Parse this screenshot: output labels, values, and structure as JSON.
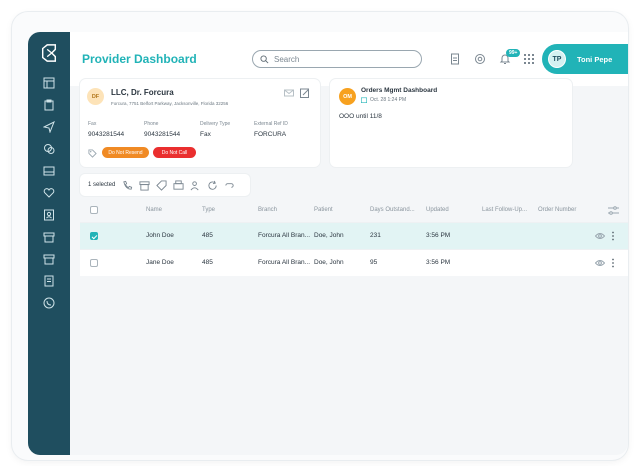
{
  "header": {
    "title": "Provider Dashboard",
    "search_placeholder": "Search",
    "notification_badge": "99+",
    "user": {
      "initials": "TP",
      "name": "Toni Pepe"
    }
  },
  "sidebar": {
    "items": [
      "dashboard",
      "clipboard",
      "send",
      "chat",
      "inbox",
      "heart",
      "contacts",
      "archive",
      "store",
      "document",
      "phone-circle"
    ]
  },
  "provider_card": {
    "initials": "DF",
    "name": "LLC, Dr. Forcura",
    "address": "Forcura, 7751 Belfort Parkway, Jacksonville, Florida 32256",
    "fields": [
      {
        "label": "Fax",
        "value": "9043281544"
      },
      {
        "label": "Phone",
        "value": "9043281544"
      },
      {
        "label": "Delivery Type",
        "value": "Fax"
      },
      {
        "label": "External Ref ID",
        "value": "FORCURA"
      }
    ],
    "tags": [
      "Do Not Resend",
      "Do Not Call"
    ]
  },
  "orders_card": {
    "initials": "OM",
    "title": "Orders Mgmt Dashboard",
    "date": "Oct. 28 1:24 PM",
    "note": "OOO until 11/8"
  },
  "action_bar": {
    "selected_text": "1 selected"
  },
  "table": {
    "columns": [
      "Name",
      "Type",
      "Branch",
      "Patient",
      "Days Outstand...",
      "Updated",
      "Last Follow-Up...",
      "Order Number"
    ],
    "rows": [
      {
        "selected": true,
        "name": "John Doe",
        "type": "485",
        "branch": "Forcura All Bran...",
        "patient": "Doe, John",
        "days": "231",
        "updated": "3:56 PM"
      },
      {
        "selected": false,
        "name": "Jane Doe",
        "type": "485",
        "branch": "Forcura All Bran...",
        "patient": "Doe, John",
        "days": "95",
        "updated": "3:56 PM"
      }
    ]
  },
  "colors": {
    "accent": "#21b3b7",
    "sidebar": "#1f4e5f",
    "orange": "#f08a24",
    "red": "#ea2f2f"
  }
}
